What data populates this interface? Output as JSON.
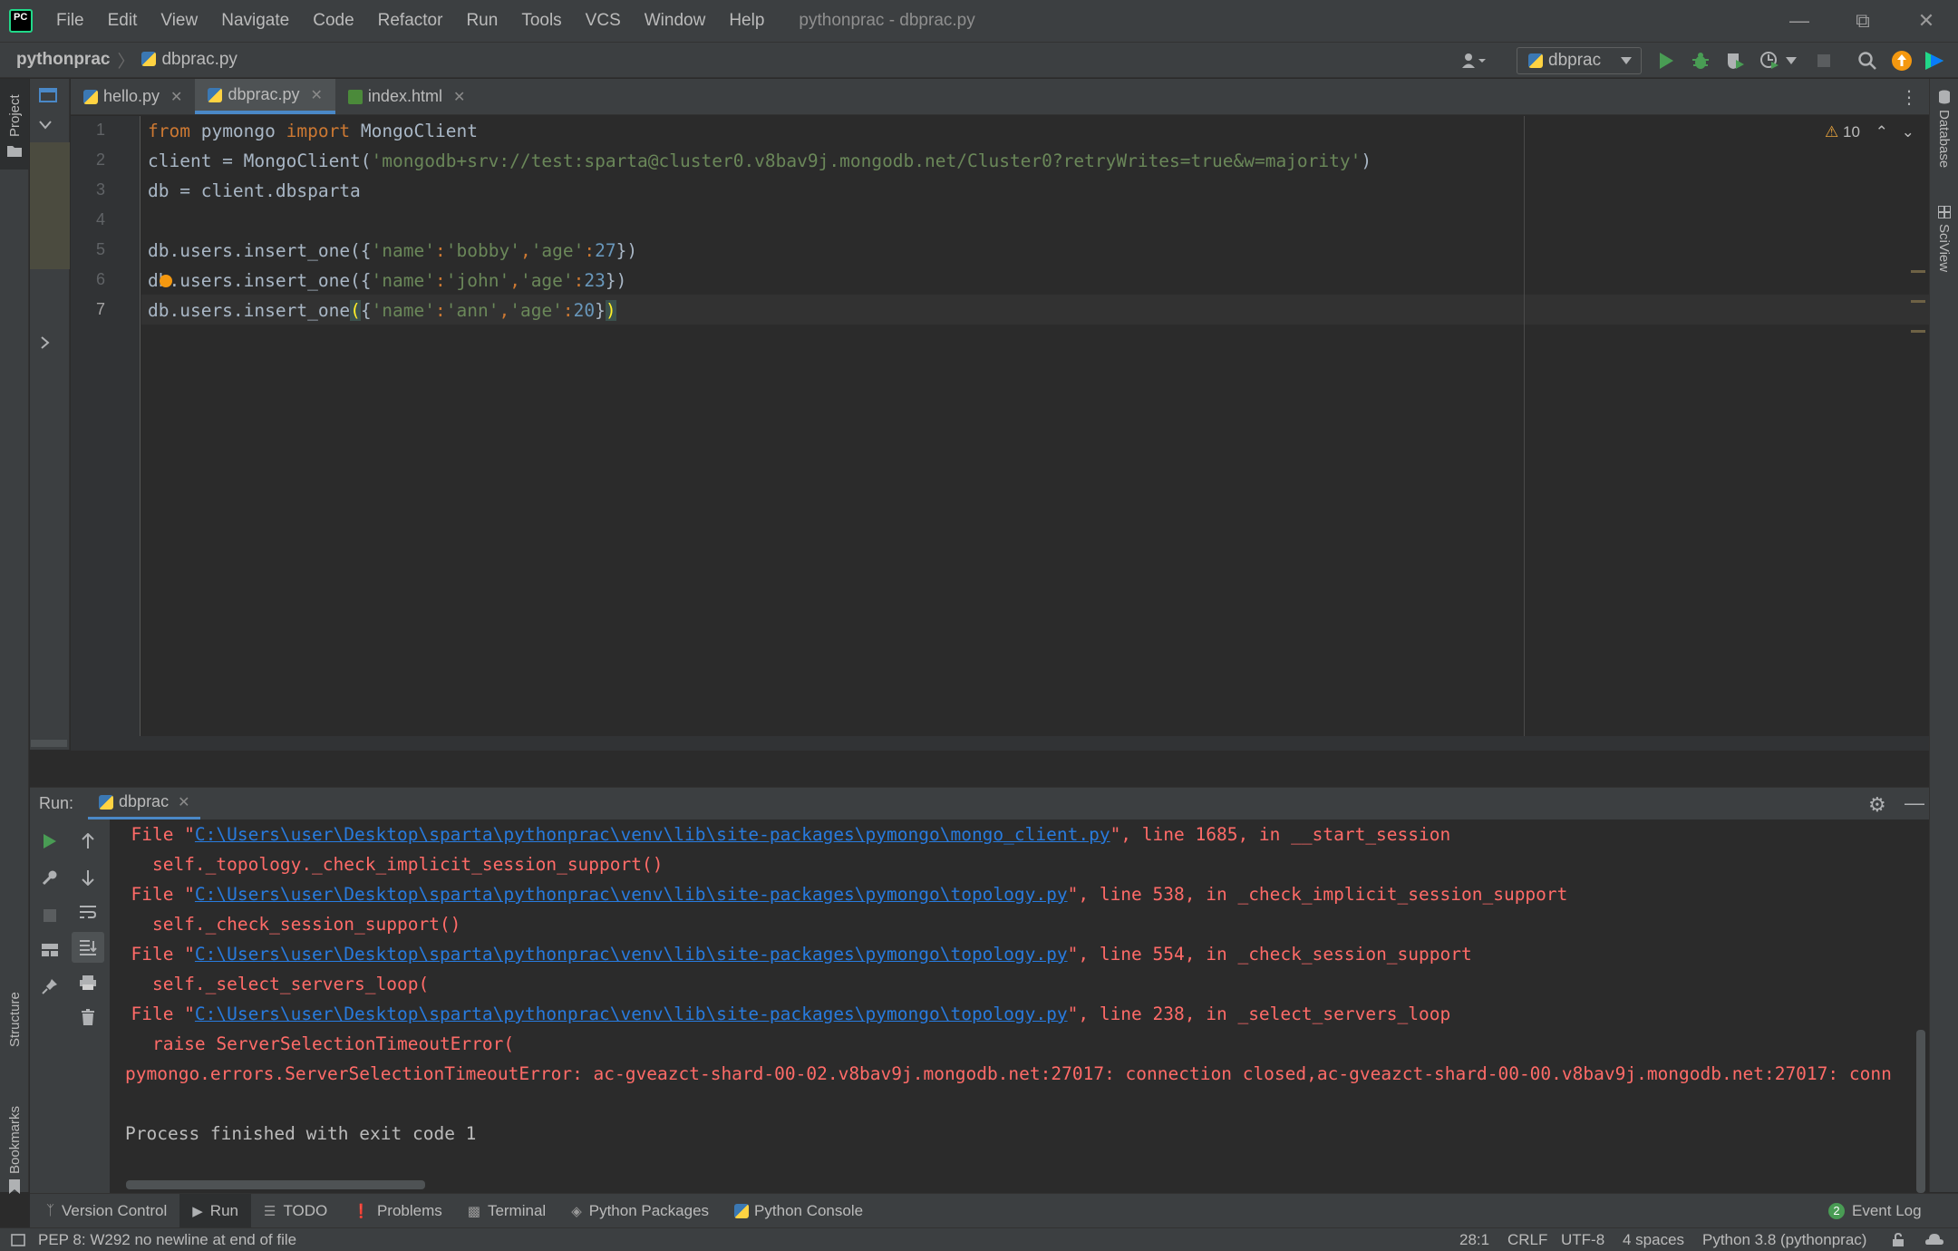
{
  "menubar": {
    "items": [
      "File",
      "Edit",
      "View",
      "Navigate",
      "Code",
      "Refactor",
      "Run",
      "Tools",
      "VCS",
      "Window",
      "Help"
    ],
    "window_title": "pythonprac - dbprac.py"
  },
  "navbar": {
    "project": "pythonprac",
    "file": "dbprac.py",
    "run_config": "dbprac"
  },
  "side_panels": {
    "left_top": "Project",
    "left_bottom_1": "Structure",
    "left_bottom_2": "Bookmarks",
    "right_1": "Database",
    "right_2": "SciView"
  },
  "editor": {
    "tabs": [
      {
        "label": "hello.py",
        "active": false
      },
      {
        "label": "dbprac.py",
        "active": true
      },
      {
        "label": "index.html",
        "active": false
      }
    ],
    "warning_count": "10",
    "line_numbers": [
      "1",
      "2",
      "3",
      "4",
      "5",
      "6",
      "7"
    ],
    "lines": {
      "l1_kw1": "from",
      "l1_mod": " pymongo ",
      "l1_kw2": "import",
      "l1_rest": " MongoClient",
      "l2_pre": "client = MongoClient(",
      "l2_str": "'mongodb+srv://test:sparta@cluster0.v8bav9j.mongodb.net/Cluster0?retryWrites=true&w=majority'",
      "l2_post": ")",
      "l3": "db = client.dbsparta",
      "l5_pre": "db.users.insert_one({",
      "l5_s1": "'name'",
      "l5_c1": ":",
      "l5_s2": "'bobby'",
      "l5_c2": ",",
      "l5_s3": "'age'",
      "l5_c3": ":",
      "l5_n": "27",
      "l5_post": "})",
      "l6_pre": "db.users.insert_one({",
      "l6_s1": "'name'",
      "l6_c1": ":",
      "l6_s2": "'john'",
      "l6_c2": ",",
      "l6_s3": "'age'",
      "l6_c3": ":",
      "l6_n": "23",
      "l6_post": "})",
      "l7_pre": "db.users.insert_one",
      "l7_paren": "(",
      "l7_brace": "{",
      "l7_s1": "'name'",
      "l7_c1": ":",
      "l7_s2": "'ann'",
      "l7_c2": ",",
      "l7_s3": "'age'",
      "l7_c3": ":",
      "l7_n": "20",
      "l7_close_brace": "}",
      "l7_close_paren": ")"
    }
  },
  "run": {
    "label": "Run:",
    "tab": "dbprac",
    "console": [
      {
        "pre": "  File \"",
        "link": "C:\\Users\\user\\Desktop\\sparta\\pythonprac\\venv\\lib\\site-packages\\pymongo\\mongo_client.py",
        "post": "\", line 1685, in __start_session"
      },
      {
        "text": "    self._topology._check_implicit_session_support()"
      },
      {
        "pre": "  File \"",
        "link": "C:\\Users\\user\\Desktop\\sparta\\pythonprac\\venv\\lib\\site-packages\\pymongo\\topology.py",
        "post": "\", line 538, in _check_implicit_session_support"
      },
      {
        "text": "    self._check_session_support()"
      },
      {
        "pre": "  File \"",
        "link": "C:\\Users\\user\\Desktop\\sparta\\pythonprac\\venv\\lib\\site-packages\\pymongo\\topology.py",
        "post": "\", line 554, in _check_session_support"
      },
      {
        "text": "    self._select_servers_loop("
      },
      {
        "pre": "  File \"",
        "link": "C:\\Users\\user\\Desktop\\sparta\\pythonprac\\venv\\lib\\site-packages\\pymongo\\topology.py",
        "post": "\", line 238, in _select_servers_loop"
      },
      {
        "text": "    raise ServerSelectionTimeoutError("
      },
      {
        "text": "pymongo.errors.ServerSelectionTimeoutError: ac-gveazct-shard-00-02.v8bav9j.mongodb.net:27017: connection closed,ac-gveazct-shard-00-00.v8bav9j.mongodb.net:27017: conn"
      },
      {
        "text": ""
      },
      {
        "text": "Process finished with exit code 1"
      }
    ]
  },
  "tool_tabs": [
    "Version Control",
    "Run",
    "TODO",
    "Problems",
    "Terminal",
    "Python Packages",
    "Python Console"
  ],
  "event_log": {
    "count": "2",
    "label": "Event Log"
  },
  "status": {
    "message": "PEP 8: W292 no newline at end of file",
    "position": "28:1",
    "line_sep": "CRLF",
    "encoding": "UTF-8",
    "indent": "4 spaces",
    "interpreter": "Python 3.8 (pythonprac)"
  },
  "colors": {
    "background": "#2b2b2b",
    "panel": "#3c3f41",
    "keyword": "#cc7832",
    "string": "#6a8759",
    "number": "#6897bb",
    "error": "#ff6b68",
    "link": "#287bde",
    "accent": "#4a88c7"
  }
}
